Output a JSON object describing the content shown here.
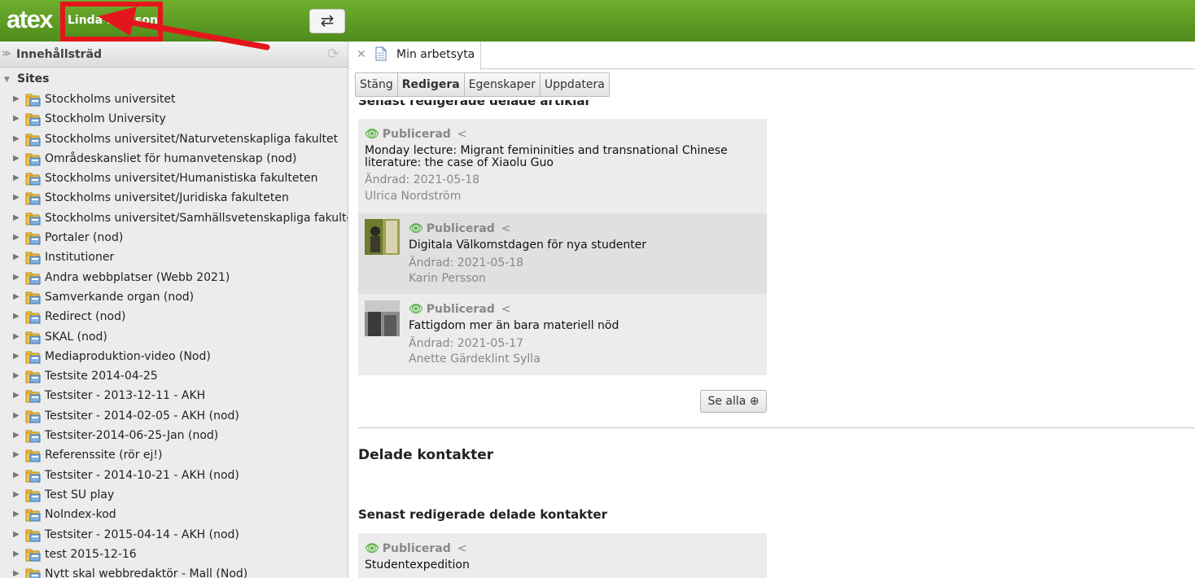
{
  "topbar": {
    "logo": "atex",
    "username": "Linda Persson",
    "switch_icon": "⇄"
  },
  "sidebar": {
    "header_title": "Innehållsträd",
    "root_label": "Sites",
    "items": [
      "Stockholms universitet",
      "Stockholm University",
      "Stockholms universitet/Naturvetenskapliga fakultet",
      "Områdeskansliet för humanvetenskap (nod)",
      "Stockholms universitet/Humanistiska fakulteten",
      "Stockholms universitet/Juridiska fakulteten",
      "Stockholms universitet/Samhällsvetenskapliga fakulteten",
      "Portaler (nod)",
      "Institutioner",
      "Andra webbplatser (Webb 2021)",
      "Samverkande organ (nod)",
      "Redirect (nod)",
      "SKAL (nod)",
      "Mediaproduktion-video (Nod)",
      "Testsite 2014-04-25",
      "Testsiter - 2013-12-11 - AKH",
      "Testsiter - 2014-02-05 - AKH (nod)",
      "Testsiter-2014-06-25-Jan (nod)",
      "Referenssite (rör ej!)",
      "Testsiter - 2014-10-21 - AKH (nod)",
      "Test SU play",
      "NoIndex-kod",
      "Testsiter - 2015-04-14 - AKH (nod)",
      "test 2015-12-16",
      "Nytt skal webbredaktör - Mall (Nod)"
    ]
  },
  "tab": {
    "label": "Min arbetsyta"
  },
  "toolbar": {
    "close": "Stäng",
    "edit": "Redigera",
    "properties": "Egenskaper",
    "refresh": "Uppdatera"
  },
  "content": {
    "cut_heading": "Senast redigerade delade artiklar",
    "articles": [
      {
        "status": "Publicerad",
        "title": "Monday lecture: Migrant femininities and transnational Chinese literature: the case of Xiaolu Guo",
        "date": "Ändrad: 2021-05-18",
        "author": "Ulrica Nordström"
      },
      {
        "status": "Publicerad",
        "title": "Digitala Välkomstdagen för nya studenter",
        "date": "Ändrad: 2021-05-18",
        "author": "Karin Persson"
      },
      {
        "status": "Publicerad",
        "title": "Fattigdom mer än bara materiell nöd",
        "date": "Ändrad: 2021-05-17",
        "author": "Anette Gärdeklint Sylla"
      }
    ],
    "see_all": "Se alla ⊕",
    "contacts_heading": "Delade kontakter",
    "recent_contacts_heading": "Senast redigerade delade kontakter",
    "contact": {
      "status": "Publicerad",
      "title": "Studentexpedition"
    }
  },
  "colors": {
    "topbar_green": "#5a9a22",
    "annotation_red": "#e4161b",
    "published_green": "#5fb548"
  }
}
